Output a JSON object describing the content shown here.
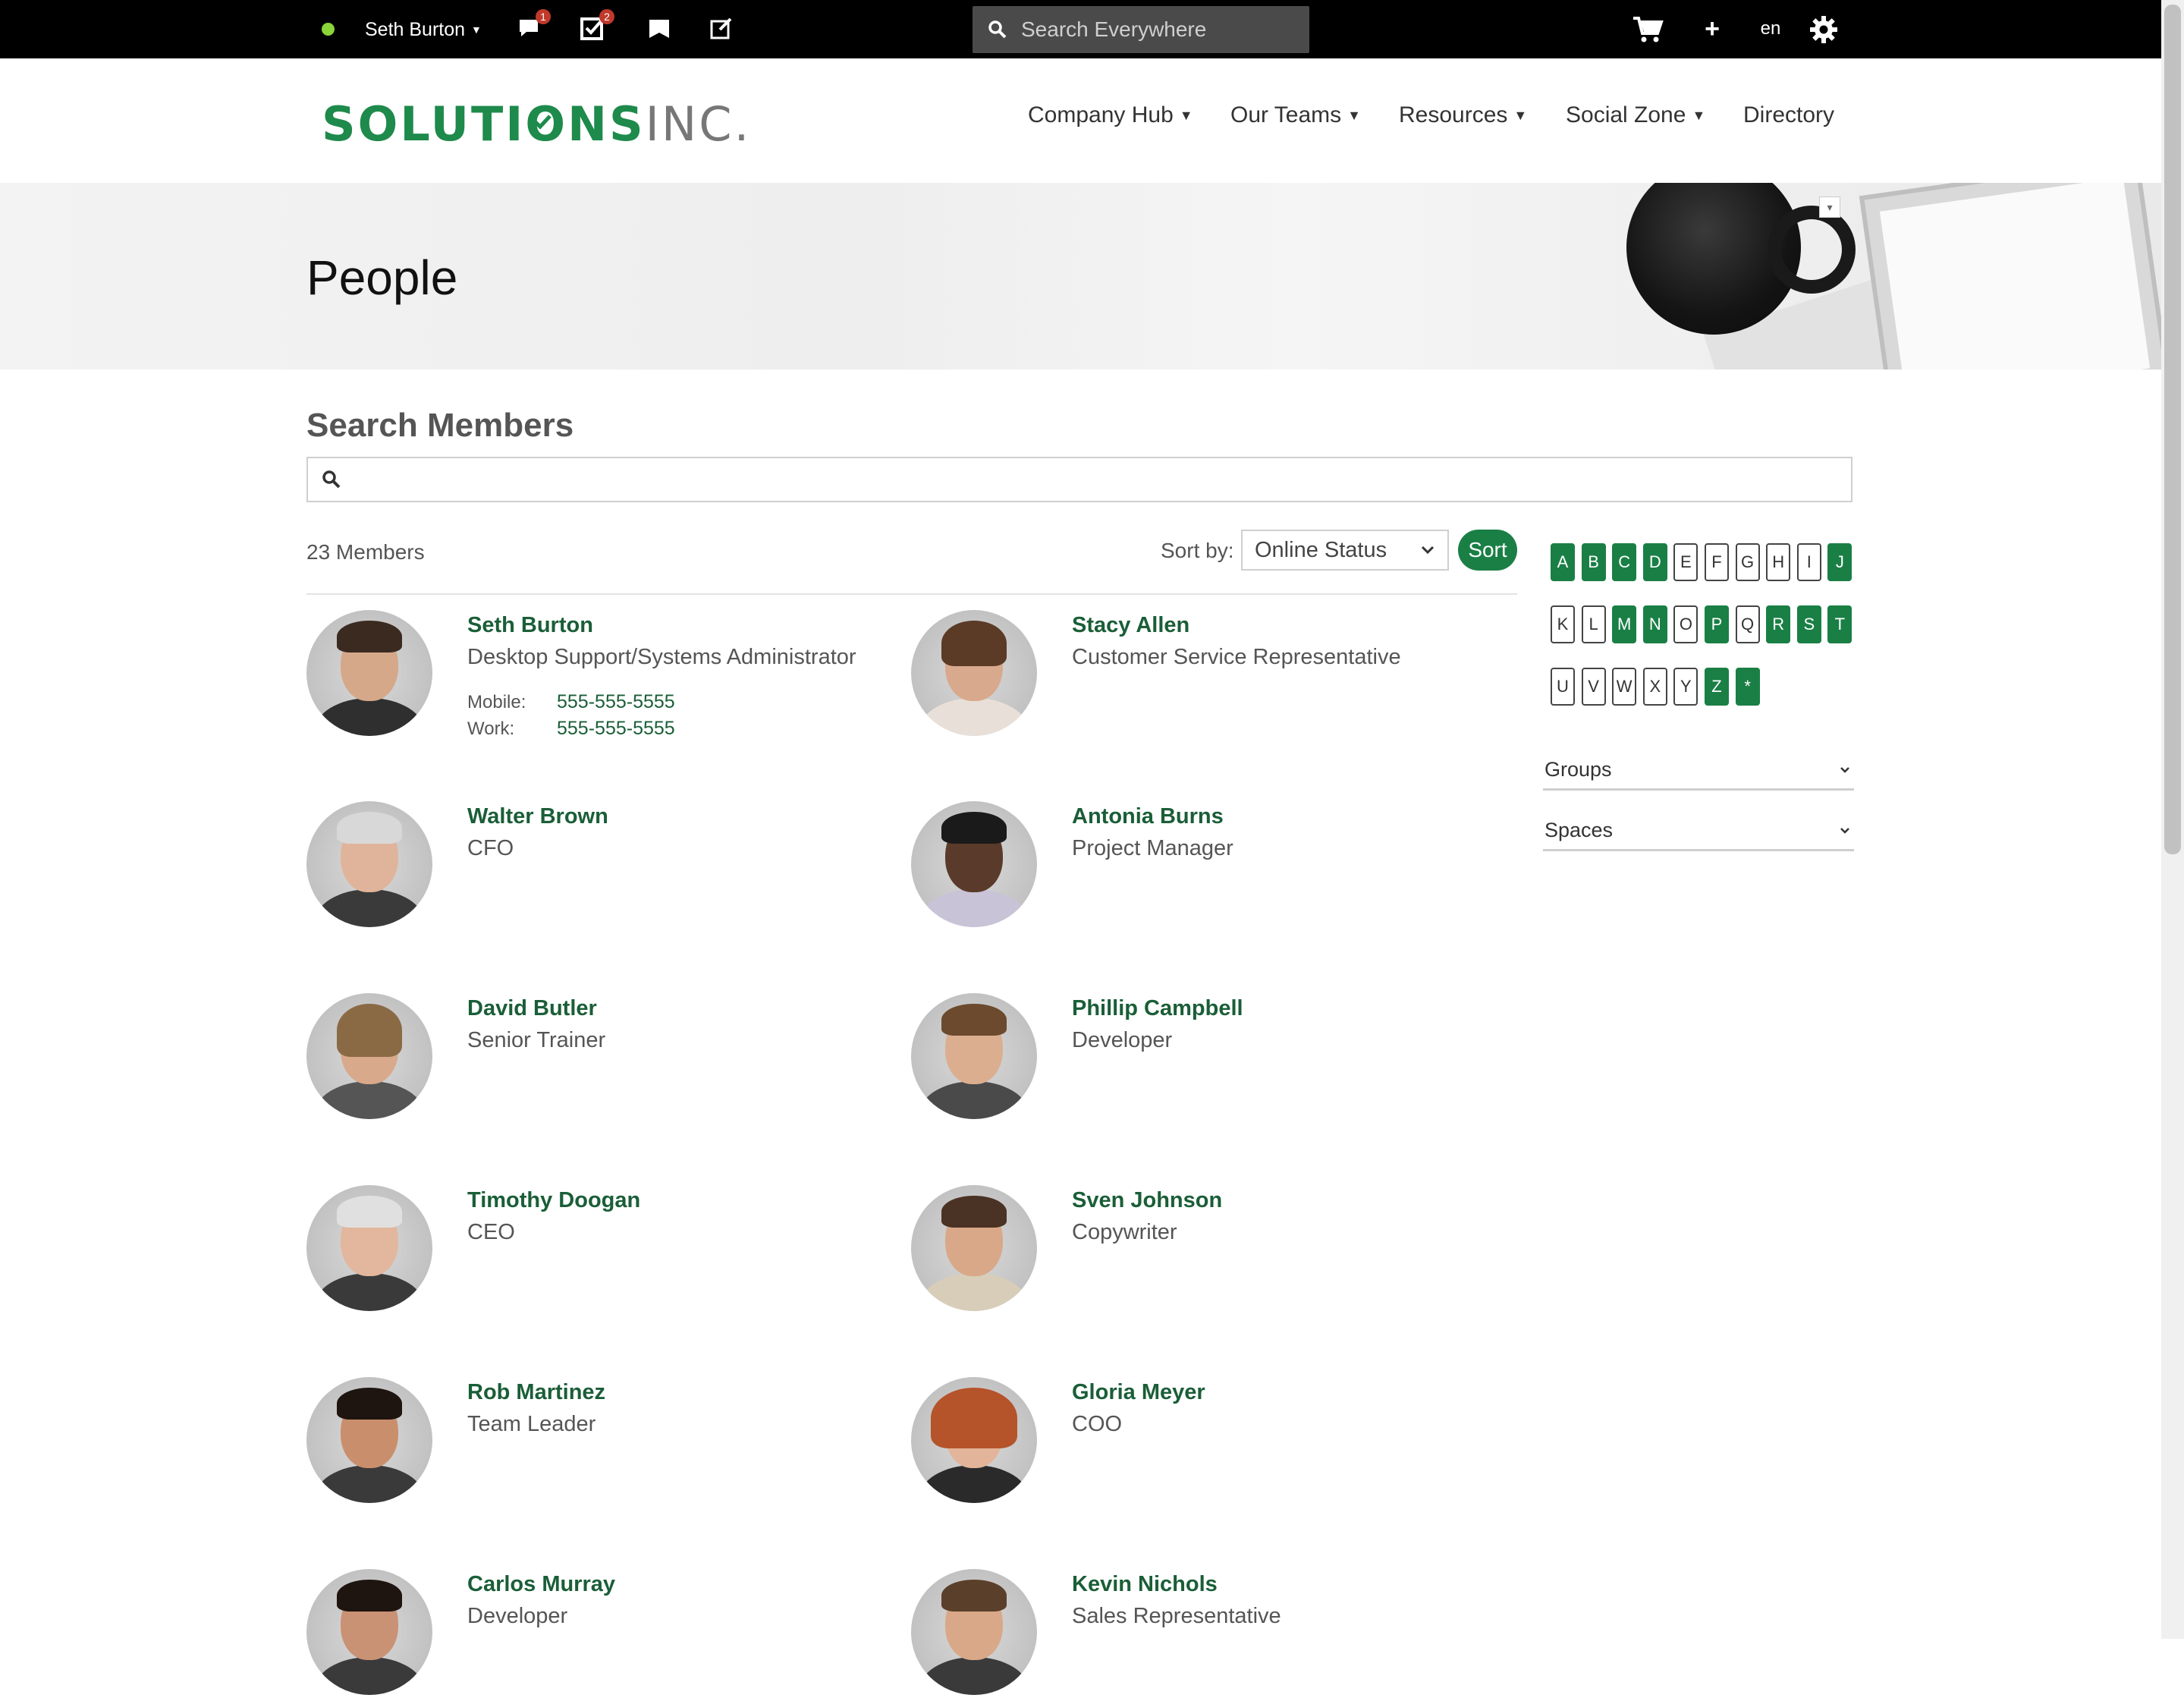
{
  "topbar": {
    "user_name": "Seth Burton",
    "messages_badge": "1",
    "tasks_badge": "2",
    "search_placeholder": "Search Everywhere",
    "language": "en",
    "status_color": "#8bd43a"
  },
  "header": {
    "logo_main": "SOLUTI",
    "logo_o": "O",
    "logo_ns": "NS",
    "logo_inc": "INC.",
    "nav": {
      "company_hub": "Company Hub",
      "our_teams": "Our Teams",
      "resources": "Resources",
      "social_zone": "Social Zone",
      "directory": "Directory"
    }
  },
  "banner": {
    "title": "People"
  },
  "search": {
    "title": "Search Members",
    "input_value": "",
    "members_count": "23 Members",
    "sort_label": "Sort by:",
    "sort_value": "Online Status",
    "sort_button": "Sort"
  },
  "members": [
    {
      "name": "Seth Burton",
      "title": "Desktop Support/Systems Administrator",
      "mobile_label": "Mobile:",
      "mobile": "555-555-5555",
      "work_label": "Work:",
      "work": "555-555-5555"
    },
    {
      "name": "Stacy Allen",
      "title": "Customer Service Representative"
    },
    {
      "name": "Walter Brown",
      "title": "CFO"
    },
    {
      "name": "Antonia Burns",
      "title": "Project Manager"
    },
    {
      "name": "David Butler",
      "title": "Senior Trainer"
    },
    {
      "name": "Phillip Campbell",
      "title": "Developer"
    },
    {
      "name": "Timothy Doogan",
      "title": "CEO"
    },
    {
      "name": "Sven Johnson",
      "title": "Copywriter"
    },
    {
      "name": "Rob Martinez",
      "title": "Team Leader"
    },
    {
      "name": "Gloria Meyer",
      "title": "COO"
    },
    {
      "name": "Carlos Murray",
      "title": "Developer"
    },
    {
      "name": "Kevin Nichols",
      "title": "Sales Representative"
    }
  ],
  "alphabet": {
    "letters": [
      "A",
      "B",
      "C",
      "D",
      "E",
      "F",
      "G",
      "H",
      "I",
      "J",
      "K",
      "L",
      "M",
      "N",
      "O",
      "P",
      "Q",
      "R",
      "S",
      "T",
      "U",
      "V",
      "W",
      "X",
      "Y",
      "Z",
      "*"
    ],
    "active": [
      "A",
      "B",
      "C",
      "D",
      "J",
      "M",
      "N",
      "P",
      "R",
      "S",
      "T",
      "Z",
      "*"
    ]
  },
  "sidebar": {
    "groups_label": "Groups",
    "spaces_label": "Spaces"
  },
  "colors": {
    "brand_green": "#1a7f45",
    "name_green": "#1a5e37",
    "topbar_bg": "#000000"
  }
}
